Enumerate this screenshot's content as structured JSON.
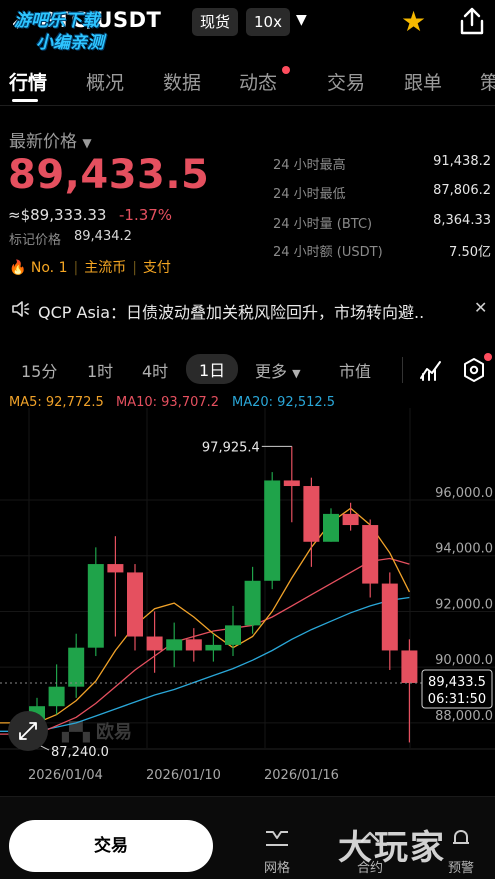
{
  "header": {
    "pair": "BTC/USDT",
    "spot_tag": "现货",
    "leverage_tag": "10x",
    "watermark_line1": "游吧乐下载",
    "watermark_line2": "小编亲测"
  },
  "tabs": [
    {
      "label": "行情"
    },
    {
      "label": "概况"
    },
    {
      "label": "数据"
    },
    {
      "label": "动态"
    },
    {
      "label": "交易"
    },
    {
      "label": "跟单"
    },
    {
      "label": "策"
    }
  ],
  "price": {
    "latest_label": "最新价格",
    "last": "89,433.5",
    "usd": "≈$89,333.33",
    "change": "-1.37%",
    "mark_label": "标记价格",
    "mark_value": "89,434.2",
    "rank": "No. 1",
    "category": "主流币",
    "payment": "支付"
  },
  "stats": [
    {
      "label": "24 小时最高",
      "value": "91,438.2"
    },
    {
      "label": "24 小时最低",
      "value": "87,806.2"
    },
    {
      "label": "24 小时量 (BTC)",
      "value": "8,364.33"
    },
    {
      "label": "24 小时额 (USDT)",
      "value": "7.50亿"
    }
  ],
  "news": {
    "text": "QCP Asia：日债波动叠加关税风险回升，市场转向避.."
  },
  "timeframes": [
    {
      "label": "15分"
    },
    {
      "label": "1时"
    },
    {
      "label": "4时"
    },
    {
      "label": "1日"
    },
    {
      "label": "更多"
    },
    {
      "label": "市值"
    }
  ],
  "ma": {
    "ma5": "MA5: 92,772.5",
    "ma10": "MA10: 93,707.2",
    "ma20": "MA20: 92,512.5"
  },
  "colors": {
    "up": "#1fa34a",
    "down": "#e5505f",
    "ma5": "#f0a229",
    "ma10": "#e5505f",
    "ma20": "#2aa7d8",
    "accent": "#f5b800"
  },
  "chart_data": {
    "type": "candlestick",
    "y_ticks": [
      "96,000.0",
      "94,000.0",
      "92,000.0",
      "90,000.0",
      "88,000.0"
    ],
    "y_tick_values": [
      96000,
      94000,
      92000,
      90000,
      88000
    ],
    "ylim": [
      87100,
      99300
    ],
    "x_ticks": [
      "2026/01/04",
      "2026/01/10",
      "2026/01/16"
    ],
    "high_label": "97,925.4",
    "low_label": "87,240.0",
    "last_price_label": "89,433.5",
    "countdown": "06:31:50",
    "candles": [
      {
        "o": 87700,
        "h": 88900,
        "l": 87240,
        "c": 88600
      },
      {
        "o": 88600,
        "h": 90100,
        "l": 88300,
        "c": 89300
      },
      {
        "o": 89300,
        "h": 91200,
        "l": 88900,
        "c": 90700
      },
      {
        "o": 90700,
        "h": 94300,
        "l": 90400,
        "c": 93700
      },
      {
        "o": 93700,
        "h": 94700,
        "l": 91100,
        "c": 93400
      },
      {
        "o": 93400,
        "h": 93700,
        "l": 90600,
        "c": 91100
      },
      {
        "o": 91100,
        "h": 92000,
        "l": 89800,
        "c": 90600
      },
      {
        "o": 90600,
        "h": 91600,
        "l": 90000,
        "c": 91000
      },
      {
        "o": 91000,
        "h": 91400,
        "l": 90200,
        "c": 90600
      },
      {
        "o": 90600,
        "h": 91200,
        "l": 90200,
        "c": 90800
      },
      {
        "o": 90800,
        "h": 92200,
        "l": 90400,
        "c": 91500
      },
      {
        "o": 91500,
        "h": 93600,
        "l": 91200,
        "c": 93100
      },
      {
        "o": 93100,
        "h": 97000,
        "l": 92800,
        "c": 96700
      },
      {
        "o": 96700,
        "h": 97925,
        "l": 95200,
        "c": 96500
      },
      {
        "o": 96500,
        "h": 96800,
        "l": 93600,
        "c": 94500
      },
      {
        "o": 94500,
        "h": 95700,
        "l": 94500,
        "c": 95500
      },
      {
        "o": 95500,
        "h": 95900,
        "l": 94900,
        "c": 95100
      },
      {
        "o": 95100,
        "h": 95300,
        "l": 92500,
        "c": 93000
      },
      {
        "o": 93000,
        "h": 93400,
        "l": 89900,
        "c": 90600
      },
      {
        "o": 90600,
        "h": 91000,
        "l": 87300,
        "c": 89433
      }
    ],
    "ma5_values": [
      88000,
      88300,
      88800,
      89500,
      90600,
      91500,
      92100,
      92300,
      91800,
      91200,
      90700,
      91100,
      92000,
      93200,
      94300,
      95200,
      95700,
      95100,
      94100,
      92700
    ],
    "ma10_values": [
      87600,
      87900,
      88200,
      88700,
      89300,
      89900,
      90400,
      90900,
      91100,
      91300,
      91400,
      91500,
      91800,
      92200,
      92600,
      93000,
      93400,
      93800,
      93900,
      93700
    ],
    "ma20_values": [
      87700,
      87850,
      88000,
      88250,
      88500,
      88750,
      89000,
      89200,
      89450,
      89700,
      89950,
      90250,
      90600,
      91000,
      91350,
      91650,
      91950,
      92200,
      92400,
      92500
    ]
  },
  "bottom": {
    "trade_label": "交易",
    "grid_label": "网格",
    "contract_label": "合约",
    "alert_label": "预警",
    "corner_text": "大玩家"
  }
}
